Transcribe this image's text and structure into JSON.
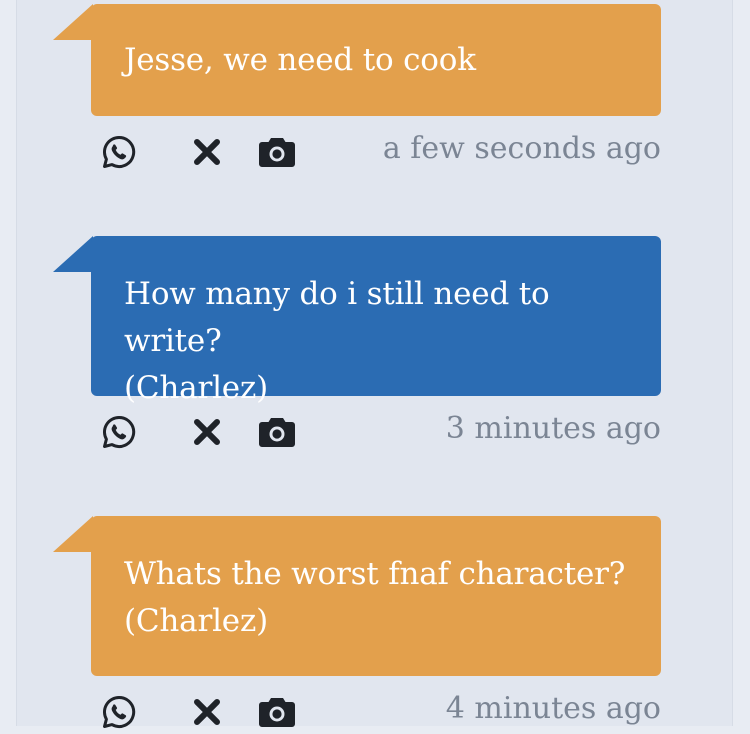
{
  "messages": [
    {
      "text_lines": [
        "Jesse, we need to cook"
      ],
      "color": "orange",
      "time": "a few seconds ago"
    },
    {
      "text_lines": [
        "How many do i still need to write?",
        "(Charlez)"
      ],
      "color": "blue",
      "time": "3 minutes ago"
    },
    {
      "text_lines": [
        "Whats the worst fnaf character?",
        "(Charlez)"
      ],
      "color": "orange",
      "time": "4 minutes ago"
    }
  ],
  "colors": {
    "orange": "#e3a04c",
    "blue": "#2b6cb3",
    "background": "#e1e6ef",
    "timestamp": "#7b8594",
    "icon": "#1f2329"
  },
  "icons": [
    "whatsapp-icon",
    "close-icon",
    "camera-icon"
  ]
}
